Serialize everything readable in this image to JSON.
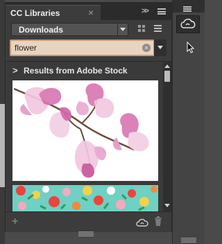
{
  "panel": {
    "tab_title": "CC Libraries",
    "close_glyph": "×",
    "collapse_glyph": ">>",
    "library": {
      "selected": "Downloads"
    },
    "search": {
      "value": "flower",
      "clear_glyph": "×"
    },
    "results": {
      "header": "Results from Adobe Stock"
    },
    "footer": {
      "add_glyph": "+"
    }
  },
  "icons": {
    "tab_close": "close-icon",
    "collapse": "double-chevron-right-icon",
    "panel_menu": "hamburger-menu-icon",
    "grid_view": "grid-view-icon",
    "list_view": "list-view-icon",
    "clear_search": "clear-circle-icon",
    "filter": "dropdown-triangle-icon",
    "results_toggle": "chevron-right-icon",
    "add": "plus-icon",
    "creative_cloud": "creative-cloud-icon",
    "trash": "trash-icon"
  },
  "colors": {
    "search_bg": "#e8d4c0",
    "search_border": "#c89a78",
    "panel_bg": "#3c3c3c",
    "petal_pink": "#e7a6cf",
    "pattern_teal": "#6fd0c3"
  }
}
